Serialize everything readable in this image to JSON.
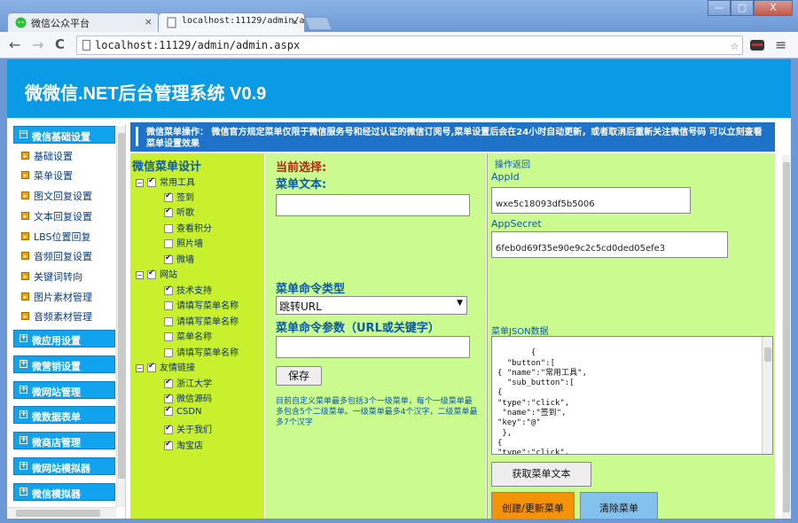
{
  "browser": {
    "tabs": [
      {
        "label": "微信公众平台",
        "close": "×"
      },
      {
        "label": "localhost:11129/admin/a",
        "close": "×"
      }
    ],
    "url": "localhost:11129/admin/admin.aspx",
    "controls": {
      "back": "←",
      "forward": "→",
      "reload": "C",
      "star": "☆",
      "menu": "≡"
    },
    "window": {
      "minimize": "—",
      "maximize": "▢",
      "close": "X"
    }
  },
  "banner": {
    "title": "微微信.NET后台管理系统 V0.9"
  },
  "sidebar": {
    "groups": [
      {
        "label": "微信基础设置",
        "toggle": "−"
      },
      {
        "label": "微应用设置",
        "toggle": "+"
      },
      {
        "label": "微营销设置",
        "toggle": "+"
      },
      {
        "label": "微网站管理",
        "toggle": "+"
      },
      {
        "label": "微数据表单",
        "toggle": "+"
      },
      {
        "label": "微商店管理",
        "toggle": "+"
      },
      {
        "label": "微网站模拟器",
        "toggle": "+"
      },
      {
        "label": "微信模拟器",
        "toggle": "+"
      }
    ],
    "items": [
      "基础设置",
      "菜单设置",
      "图文回复设置",
      "文本回复设置",
      "LBS位置回复",
      "音频回复设置",
      "关键词转向",
      "图片素材管理",
      "音频素材管理"
    ]
  },
  "notice": {
    "text": "微信菜单操作： 微信官方规定菜单仅限于微信服务号和经过认证的微信订阅号,菜单设置后会在24小时自动更新，或者取消后重新关注微信号码 可以立刻查看菜单设置效果"
  },
  "tree": {
    "title": "微信菜单设计",
    "groups": [
      {
        "label": "常用工具",
        "children": [
          {
            "label": "签到",
            "checked": true
          },
          {
            "label": "听歌",
            "checked": true
          },
          {
            "label": "查看积分",
            "checked": false
          },
          {
            "label": "照片墙",
            "checked": false
          },
          {
            "label": "微墙",
            "checked": true
          }
        ]
      },
      {
        "label": "网站",
        "children": [
          {
            "label": "技术支持",
            "checked": true
          },
          {
            "label": "请填写菜单名称",
            "checked": false
          },
          {
            "label": "请填写菜单名称",
            "checked": false
          },
          {
            "label": "菜单名称",
            "checked": false
          },
          {
            "label": "请填写菜单名称",
            "checked": false
          }
        ]
      },
      {
        "label": "友情链接",
        "children": [
          {
            "label": "浙江大学",
            "checked": true
          },
          {
            "label": "微信源码",
            "checked": true
          },
          {
            "label": "CSDN",
            "checked": true
          },
          {
            "label": "关于我们",
            "checked": true
          },
          {
            "label": "淘宝店",
            "checked": true
          }
        ]
      }
    ]
  },
  "form": {
    "current_selection": "当前选择:",
    "menu_text_label": "菜单文本:",
    "menu_text_value": "",
    "command_type_label": "菜单命令类型",
    "command_type_value": "跳转URL",
    "command_param_label": "菜单命令参数（URL或关键字）",
    "command_param_value": "",
    "save_label": "保存",
    "note": "目前自定义菜单最多包括3个一级菜单，每个一级菜单最多包含5个二级菜单。一级菜单最多4个汉字，二级菜单最多7个汉字"
  },
  "ops": {
    "title": "操作返回",
    "appid_label": "AppId",
    "appid_value": "wxe5c18093df5b5006",
    "appsecret_label": "AppSecret",
    "appsecret_value": "6feb0d69f35e90e9c2c5cd0ded05efe3",
    "json_label": "菜单JSON数据",
    "json_text": " {\n  \"button\":[\n{ \"name\":\"常用工具\",\n  \"sub_button\":[\n{\n\"type\":\"click\",\n \"name\":\"签到\",\n\"key\":\"@\"\n },\n{\n\"type\":\"click\",",
    "get_menu_label": "获取菜单文本",
    "create_label": "创建/更新菜单",
    "clear_label": "清除菜单"
  },
  "colors": {
    "banner": "#0a9ae6",
    "notice": "#1e73c8",
    "tree_bg": "#c8f02c",
    "form_bg": "#cbfb8e",
    "create_btn": "#f49208",
    "clear_btn": "#83c2ec"
  }
}
